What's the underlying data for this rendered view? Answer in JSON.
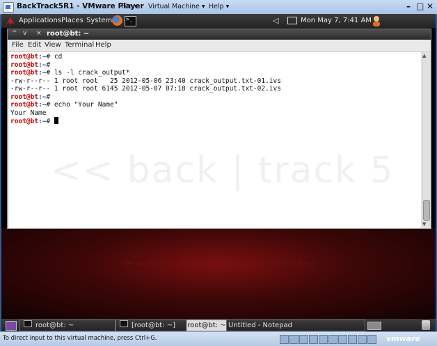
{
  "vmware": {
    "title": "BackTrack5R1 - VMware Player",
    "menu": [
      "File ▾",
      "Virtual Machine ▾",
      "Help ▾"
    ],
    "status": "To direct input to this virtual machine, press Ctrl+G.",
    "logo": "vmware"
  },
  "top_panel": {
    "applications": "Applications",
    "places": "Places",
    "system": "System",
    "clock": "Mon May  7,  7:41 AM"
  },
  "terminal": {
    "title": "root@bt: ~",
    "menu": [
      "File",
      "Edit",
      "View",
      "Terminal",
      "Help"
    ],
    "lines": [
      {
        "user": "root@bt",
        "path": ":~",
        "cmd": "# cd"
      },
      {
        "user": "root@bt",
        "path": ":~",
        "cmd": "#"
      },
      {
        "user": "root@bt",
        "path": ":~",
        "cmd": "# ls -l crack_output*"
      },
      {
        "text": "-rw-r--r-- 1 root root   25 2012-05-06 23:40 crack_output.txt-01.ivs"
      },
      {
        "text": "-rw-r--r-- 1 root root 6145 2012-05-07 07:18 crack_output.txt-02.ivs"
      },
      {
        "user": "root@bt",
        "path": ":~",
        "cmd": "#"
      },
      {
        "user": "root@bt",
        "path": ":~",
        "cmd": "# echo \"Your Name\""
      },
      {
        "text": "Your Name"
      },
      {
        "user": "root@bt",
        "path": ":~",
        "cmd": "# "
      }
    ],
    "watermark": "<< back | track 5"
  },
  "desktop": {
    "motto": "the quieter you become, the more you are able to hear"
  },
  "taskbar": {
    "items": [
      "root@bt: ~",
      "[root@bt: ~]",
      "root@bt: ~",
      "Untitled - Notepad"
    ]
  }
}
